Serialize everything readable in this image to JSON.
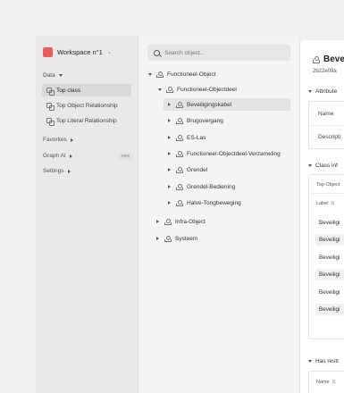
{
  "sidebar": {
    "workspace": {
      "name": "Workspace n°1",
      "logo_color": "#ef5b5b"
    },
    "data_section": "Data",
    "items": [
      {
        "label": "Top class",
        "active": true
      },
      {
        "label": "Top Object Relationship",
        "active": false
      },
      {
        "label": "Top Literal Relationship",
        "active": false
      }
    ],
    "favorites": "Favorites",
    "graph_ai": "Graph AI",
    "graph_ai_badge": "new",
    "settings": "Settings"
  },
  "search": {
    "placeholder": "Search object..",
    "value": ""
  },
  "tree": [
    {
      "label": "Functioneel-Object",
      "depth": 0,
      "expanded": true
    },
    {
      "label": "Functioneel-Objectdeel",
      "depth": 1,
      "expanded": true
    },
    {
      "label": "Beveiligingskabel",
      "depth": 2,
      "expanded": false,
      "selected": true
    },
    {
      "label": "Brugovergang",
      "depth": 2,
      "expanded": false
    },
    {
      "label": "ES-Las",
      "depth": 2,
      "expanded": false
    },
    {
      "label": "Functioneel-Objectdeel-Verzameling",
      "depth": 2,
      "expanded": false
    },
    {
      "label": "Grendel",
      "depth": 2,
      "expanded": false
    },
    {
      "label": "Grendel-Bediening",
      "depth": 2,
      "expanded": false
    },
    {
      "label": "Halve-Tongbeweging",
      "depth": 2,
      "expanded": false
    },
    {
      "label": "Infra-Object",
      "depth": 1,
      "expanded": false
    },
    {
      "label": "Systeem",
      "depth": 1,
      "expanded": false
    }
  ],
  "detail": {
    "title": "Beve",
    "subtitle": "2b22e09a",
    "attributes_section": "Attribute",
    "fields": [
      "Name",
      "Descripti"
    ],
    "class_section": "Class inf",
    "top_object": "Top Object",
    "label_header": "Label",
    "rows": [
      "Beveiligi",
      "Beveiligi",
      "Beveiligi",
      "Beveiligi",
      "Beveiligi",
      "Beveiligi"
    ],
    "restrict_section": "Has restr",
    "name_header": "Name"
  }
}
